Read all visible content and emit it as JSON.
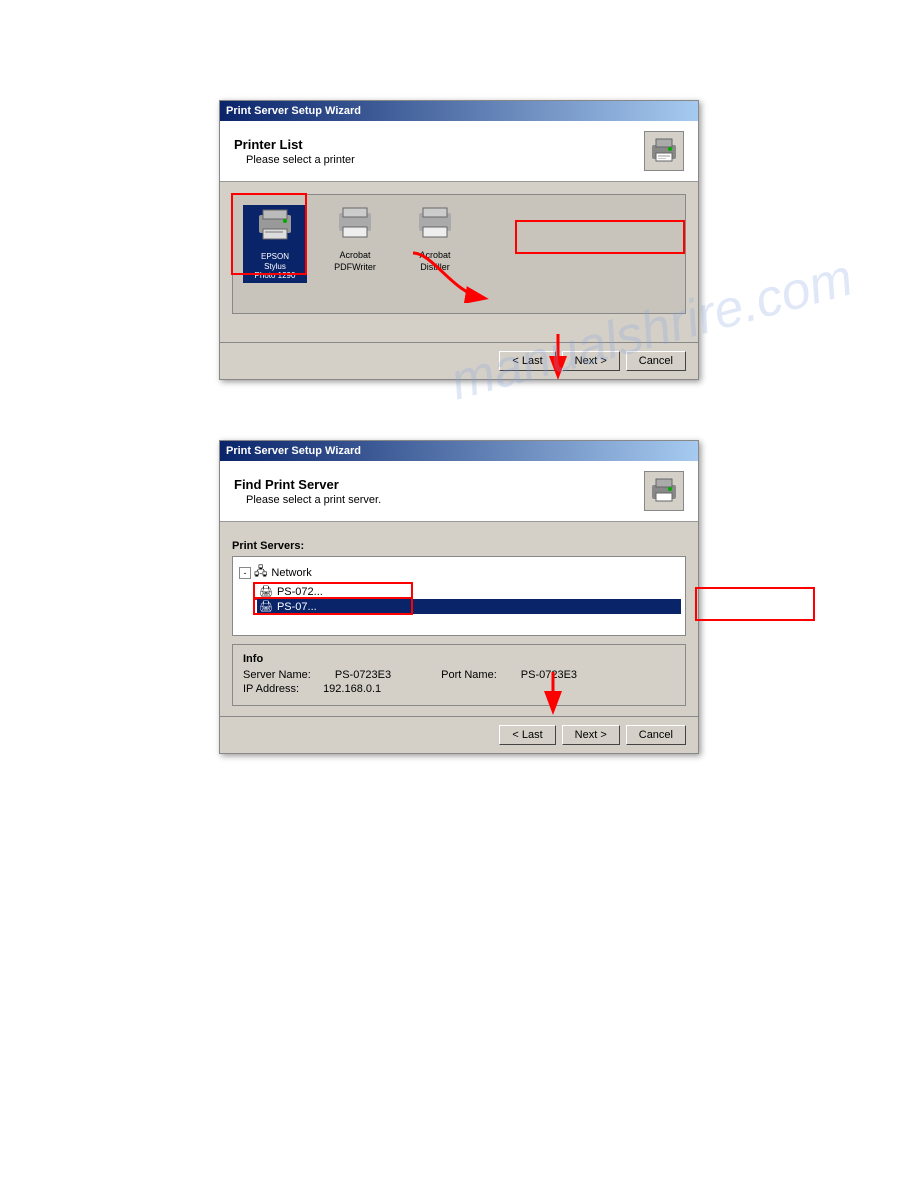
{
  "page": {
    "background": "#ffffff"
  },
  "watermark": {
    "text": "manualshrire.com"
  },
  "dialog1": {
    "title": "Print Server Setup Wizard",
    "header": {
      "heading": "Printer  List",
      "subtext": "Please select a printer"
    },
    "printers": [
      {
        "id": "epson",
        "label": "EPSON\nStylus\nPhoto 1290",
        "selected": true
      },
      {
        "id": "acrobat-pdf",
        "label": "Acrobat\nPDFWriter",
        "selected": false
      },
      {
        "id": "acrobat-distiller",
        "label": "Acrobat\nDistiller",
        "selected": false
      }
    ],
    "buttons": {
      "last": "< Last",
      "next": "Next >",
      "cancel": "Cancel"
    }
  },
  "dialog2": {
    "title": "Print Server Setup Wizard",
    "header": {
      "heading": "Find Print Server",
      "subtext": "Please select a print server."
    },
    "print_servers_label": "Print Servers:",
    "network": {
      "label": "Network",
      "items": [
        {
          "id": "ps-0723e3-1",
          "label": "PS-072...",
          "selected": false
        },
        {
          "id": "ps-0723e3-2",
          "label": "PS-07...",
          "selected": true
        }
      ]
    },
    "info": {
      "label": "Info",
      "server_name_label": "Server Name:",
      "server_name_value": "PS-0723E3",
      "port_name_label": "Port Name:",
      "port_name_value": "PS-0723E3",
      "ip_label": "IP Address:",
      "ip_value": "192.168.0.1"
    },
    "buttons": {
      "last": "< Last",
      "next": "Next >",
      "cancel": "Cancel"
    }
  }
}
